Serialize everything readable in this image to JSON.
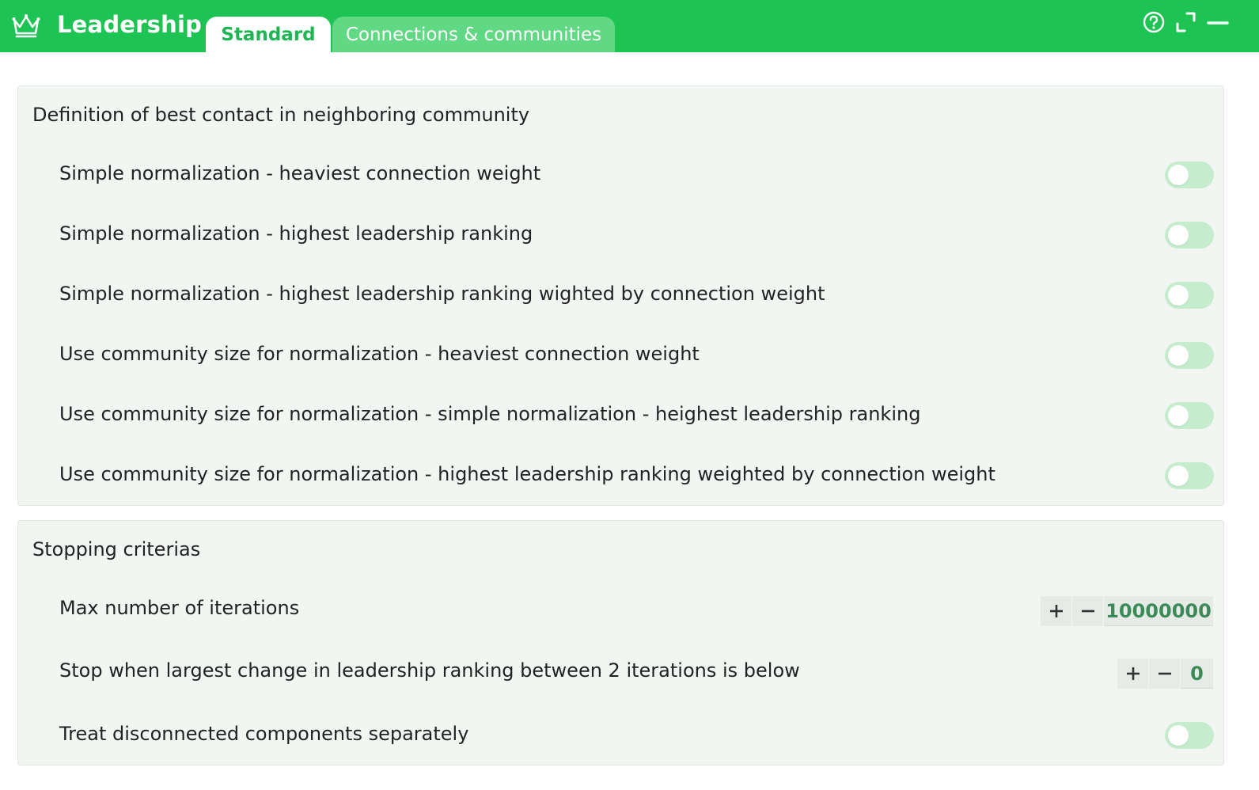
{
  "app": {
    "title": "Leadership",
    "icon": "crown-icon",
    "accent_color": "#1dc454"
  },
  "tabs": [
    {
      "label": "Standard",
      "active": true
    },
    {
      "label": "Connections & communities",
      "active": false
    }
  ],
  "window_controls": [
    "help-icon",
    "expand-icon",
    "minimize-icon"
  ],
  "best_contact": {
    "title": "Definition of best contact in neighboring community",
    "options": [
      {
        "label": "Simple normalization - heaviest connection weight",
        "enabled": false
      },
      {
        "label": "Simple normalization - highest leadership ranking",
        "enabled": false
      },
      {
        "label": "Simple normalization - highest leadership ranking wighted by connection weight",
        "enabled": false
      },
      {
        "label": "Use community size for normalization - heaviest connection weight",
        "enabled": false
      },
      {
        "label": "Use community size for normalization - simple normalization - heighest leadership ranking",
        "enabled": false
      },
      {
        "label": "Use community size for normalization - highest leadership ranking weighted by connection weight",
        "enabled": false
      }
    ]
  },
  "stopping": {
    "title": "Stopping criterias",
    "max_iterations": {
      "label": "Max number of iterations",
      "value": "10000000"
    },
    "largest_change": {
      "label": "Stop when largest change in leadership ranking between 2 iterations is below",
      "value": "0"
    },
    "disconnected": {
      "label": "Treat disconnected components separately",
      "enabled": false
    }
  }
}
